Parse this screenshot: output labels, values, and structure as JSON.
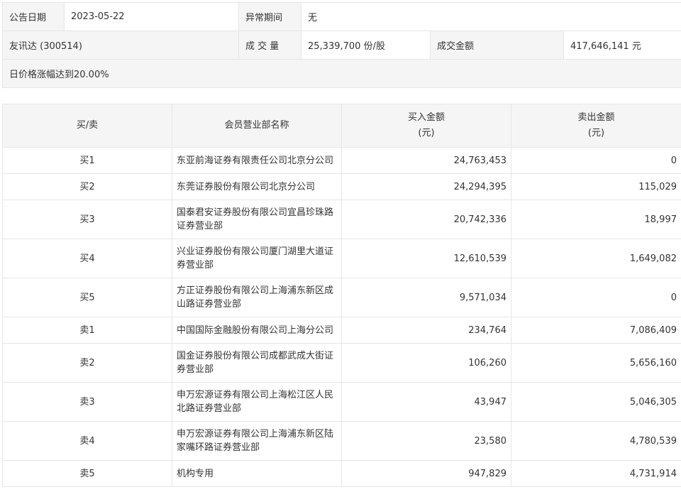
{
  "info": {
    "date_label": "公告日期",
    "date_value": "2023-05-22",
    "abnormal_label": "异常期间",
    "abnormal_value": "无",
    "stock": "友讯达 (300514)",
    "volume_label": "成 交 量",
    "volume_value": "25,339,700 份/股",
    "amount_label": "成交金额",
    "amount_value": "417,646,141 元",
    "reason": "日价格涨幅达到20.00%"
  },
  "table": {
    "headers": {
      "side": "买/卖",
      "name": "会员营业部名称",
      "buy_line1": "买入金额",
      "buy_line2": "(元)",
      "sell_line1": "卖出金额",
      "sell_line2": "(元)"
    },
    "rows": [
      {
        "side": "买1",
        "name": "东亚前海证券有限责任公司北京分公司",
        "buy": "24,763,453",
        "sell": "0"
      },
      {
        "side": "买2",
        "name": "东莞证券股份有限公司北京分公司",
        "buy": "24,294,395",
        "sell": "115,029"
      },
      {
        "side": "买3",
        "name": "国泰君安证券股份有限公司宜昌珍珠路证券营业部",
        "buy": "20,742,336",
        "sell": "18,997"
      },
      {
        "side": "买4",
        "name": "兴业证券股份有限公司厦门湖里大道证券营业部",
        "buy": "12,610,539",
        "sell": "1,649,082"
      },
      {
        "side": "买5",
        "name": "方正证券股份有限公司上海浦东新区成山路证券营业部",
        "buy": "9,571,034",
        "sell": "0"
      },
      {
        "side": "卖1",
        "name": "中国国际金融股份有限公司上海分公司",
        "buy": "234,764",
        "sell": "7,086,409"
      },
      {
        "side": "卖2",
        "name": "国金证券股份有限公司成都武成大街证券营业部",
        "buy": "106,260",
        "sell": "5,656,160"
      },
      {
        "side": "卖3",
        "name": "申万宏源证券有限公司上海松江区人民北路证券营业部",
        "buy": "43,947",
        "sell": "5,046,305"
      },
      {
        "side": "卖4",
        "name": "申万宏源证券有限公司上海浦东新区陆家嘴环路证券营业部",
        "buy": "23,580",
        "sell": "4,780,539"
      },
      {
        "side": "卖5",
        "name": "机构专用",
        "buy": "947,829",
        "sell": "4,731,914"
      }
    ]
  }
}
